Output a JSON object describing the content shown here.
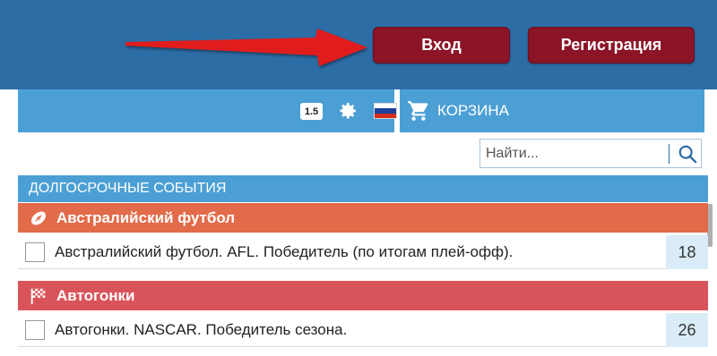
{
  "header": {
    "login_label": "Вход",
    "register_label": "Регистрация",
    "brand_color": "#2d6da6",
    "button_color": "#8b1427"
  },
  "toolbar": {
    "odds_format": "1.5",
    "settings_icon": "gear-icon",
    "language_flag": "russia-flag",
    "cart_label": "КОРЗИНА"
  },
  "search": {
    "placeholder": "Найти..."
  },
  "section": {
    "title": "ДОЛГОСРОЧНЫЕ СОБЫТИЯ"
  },
  "categories": [
    {
      "name": "Австралийский футбол",
      "icon": "football-icon",
      "color": "#e26b4a",
      "events": [
        {
          "title": "Австралийский футбол. AFL. Победитель (по итогам плей-офф).",
          "count": "18"
        }
      ]
    },
    {
      "name": "Автогонки",
      "icon": "checkered-flag-icon",
      "color": "#d9545a",
      "events": [
        {
          "title": "Автогонки. NASCAR. Победитель сезона.",
          "count": "26"
        }
      ]
    }
  ]
}
